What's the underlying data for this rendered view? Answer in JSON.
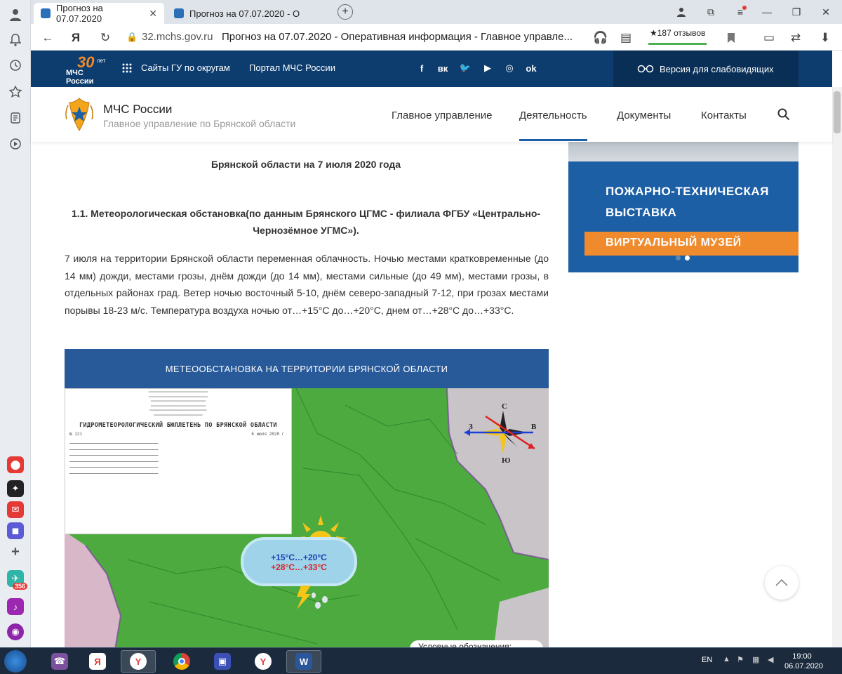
{
  "browser": {
    "tabs": [
      {
        "title": "Прогноз на 07.07.2020"
      },
      {
        "title": "Прогноз на 07.07.2020 - О"
      }
    ],
    "domain": "32.mchs.gov.ru",
    "page_title": "Прогноз на 07.07.2020 - Оперативная информация - Главное управле...",
    "reviews": "★187 отзывов",
    "yandex_letter": "Я"
  },
  "site_top": {
    "logo_number": "30",
    "logo_suffix": "лет",
    "logo_text": "МЧС России",
    "link1": "Сайты ГУ по округам",
    "link2": "Портал МЧС России",
    "vision": "Версия для слабовидящих"
  },
  "header": {
    "brand": "МЧС России",
    "brand_sub": "Главное управление по Брянской области",
    "menu": [
      "Главное управление",
      "Деятельность",
      "Документы",
      "Контакты"
    ],
    "active_menu": "Деятельность"
  },
  "content": {
    "heading": "Брянской области на 7 июля 2020 года",
    "subheading": "1.1. Метеорологическая обстановка(по данным Брянского ЦГМС - филиала ФГБУ «Центрально-Чернозёмное УГМС»).",
    "paragraph": "7 июля на территории Брянской области переменная облачность. Ночью местами кратковременные (до 14 мм) дожди, местами грозы, днём дожди (до 14 мм), местами сильные (до 49 мм), местами грозы, в отдельных районах град. Ветер ночью восточный 5-10, днём северо-западный 7-12, при грозах местами порывы 18-23 м/с. Температура воздуха ночью от…+15°С до…+20°С, днем от…+28°С до…+33°С."
  },
  "map": {
    "banner": "МЕТЕООБСТАНОВКА НА ТЕРРИТОРИИ БРЯНСКОЙ ОБЛАСТИ",
    "bulletin_title": "ГИДРОМЕТЕОРОЛОГИЧЕСКИЙ БЮЛЛЕТЕНЬ ПО БРЯНСКОЙ ОБЛАСТИ",
    "bulletin_no": "№ 121",
    "bulletin_date": "6 июля 2020 г.",
    "temp_night": "+15°C…+20°C",
    "temp_day": "+28°C…+33°C",
    "compass": {
      "n": "С",
      "s": "Ю",
      "w": "З",
      "e": "В"
    },
    "legend": "Условные обозначения:"
  },
  "promo": {
    "line1": "ПОЖАРНО-ТЕХНИЧЕСКАЯ",
    "line2": "ВЫСТАВКА",
    "band": "ВИРТУАЛЬНЫЙ МУЗЕЙ"
  },
  "taskbar": {
    "lang": "EN",
    "time": "19:00",
    "date": "06.07.2020"
  },
  "left_rail": {
    "badge": "356"
  },
  "colors": {
    "nav_dark": "#0d3c6e",
    "accent_orange": "#ef8a2d",
    "promo_blue": "#1c5fa5",
    "map_green": "#4caa3f"
  }
}
